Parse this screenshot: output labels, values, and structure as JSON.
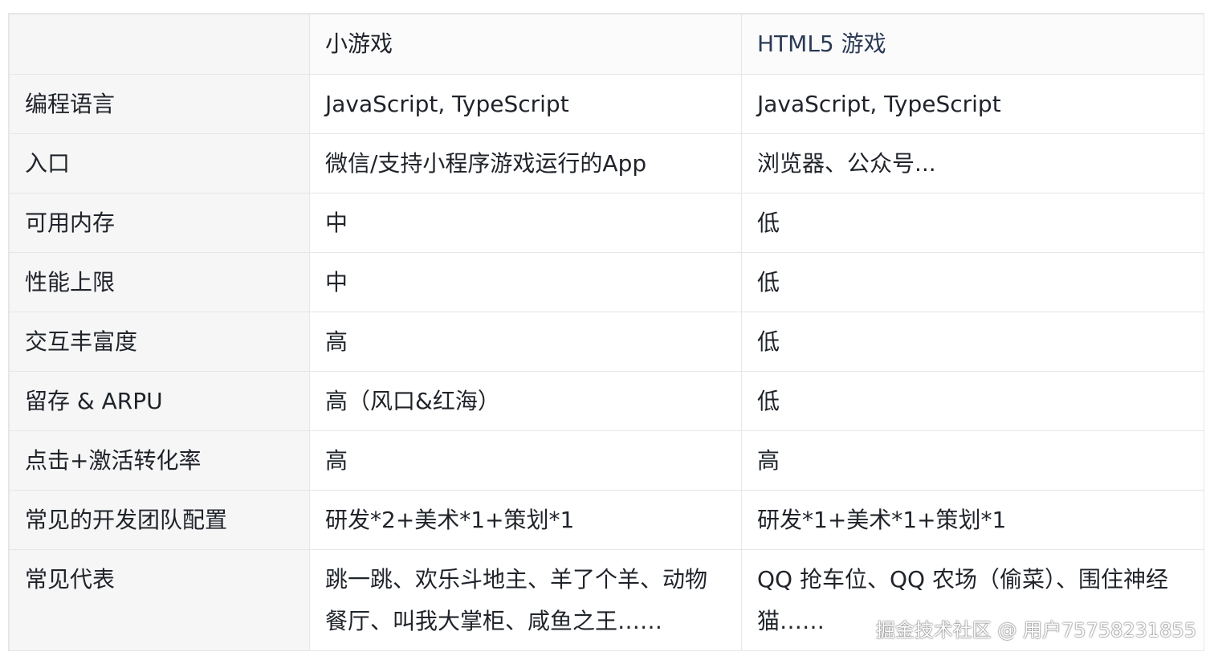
{
  "table": {
    "headers": [
      "",
      "小游戏",
      "HTML5 游戏"
    ],
    "rows": [
      {
        "label": "编程语言",
        "mini": "JavaScript, TypeScript",
        "html5": "JavaScript, TypeScript"
      },
      {
        "label": "入口",
        "mini": "微信/支持小程序游戏运行的App",
        "html5": "浏览器、公众号..."
      },
      {
        "label": "可用内存",
        "mini": "中",
        "html5": "低"
      },
      {
        "label": "性能上限",
        "mini": "中",
        "html5": "低"
      },
      {
        "label": "交互丰富度",
        "mini": "高",
        "html5": "低"
      },
      {
        "label": "留存 & ARPU",
        "mini": "高（风口&红海）",
        "html5": "低"
      },
      {
        "label": "点击+激活转化率",
        "mini": "高",
        "html5": "高"
      },
      {
        "label": "常见的开发团队配置",
        "mini": "研发*2+美术*1+策划*1",
        "html5": "研发*1+美术*1+策划*1"
      },
      {
        "label": "常见代表",
        "mini": "跳一跳、欢乐斗地主、羊了个羊、动物餐厅、叫我大掌柜、咸鱼之王……",
        "html5": "QQ 抢车位、QQ 农场（偷菜）、围住神经猫……"
      }
    ]
  },
  "watermark": "掘金技术社区 @ 用户75758231855"
}
